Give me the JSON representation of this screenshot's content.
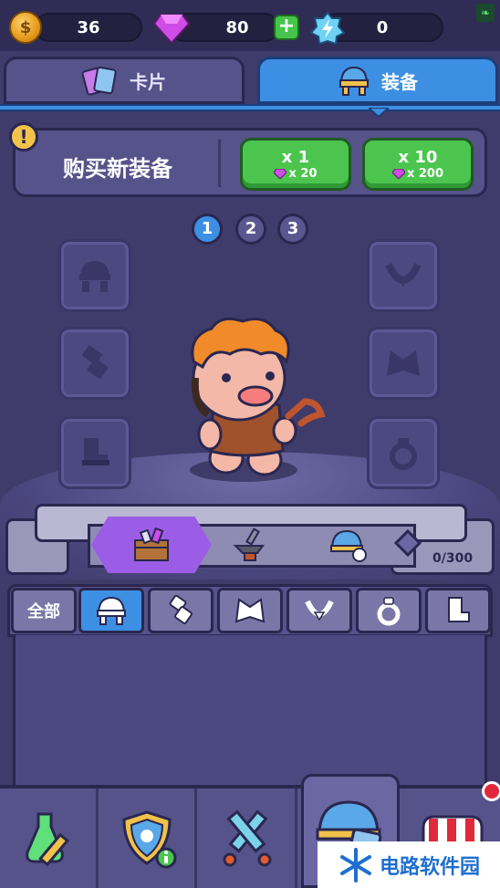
{
  "currency": {
    "coins": "36",
    "gems": "80",
    "energy": "0"
  },
  "tabs": [
    {
      "label": "卡片",
      "active": false
    },
    {
      "label": "装备",
      "active": true
    }
  ],
  "buy": {
    "title": "购买新装备",
    "single": {
      "label": "x 1",
      "cost": "x 20"
    },
    "multi": {
      "label": "x 10",
      "cost": "x 200"
    }
  },
  "pages": [
    "1",
    "2",
    "3"
  ],
  "active_page": "1",
  "inventory": {
    "count": "0/300"
  },
  "filters": {
    "all_label": "全部",
    "icons": [
      "helmet-icon",
      "armor-icon",
      "cape-icon",
      "necklace-icon",
      "ring-icon",
      "boots-icon"
    ]
  },
  "watermark": "电路软件园",
  "colors": {
    "accent": "#3d8fe3",
    "panel": "#56528a",
    "bg": "#3f3b6b",
    "green": "#4bc54e",
    "purple": "#9b5de5"
  }
}
